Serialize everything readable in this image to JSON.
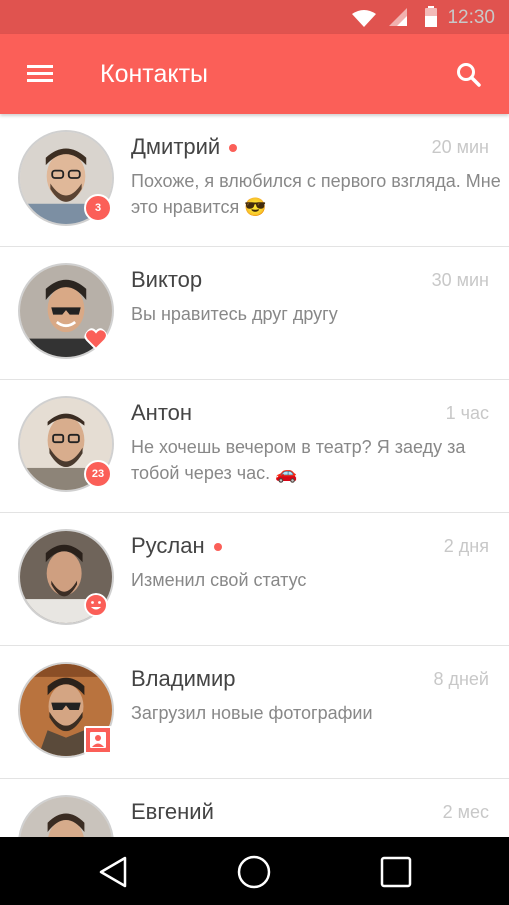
{
  "status_bar": {
    "time": "12:30",
    "icons": [
      "wifi-icon",
      "signal-icon",
      "battery-icon"
    ]
  },
  "app_bar": {
    "title": "Контакты",
    "left_icon": "menu-icon",
    "right_icon": "search-icon"
  },
  "contacts": [
    {
      "name": "Дмитрий",
      "online": true,
      "time": "20 мин",
      "message": "Похоже, я влюбился с первого взгляда. Мне это нравится 😎",
      "badge": "3"
    },
    {
      "name": "Виктор",
      "online": false,
      "time": "30 мин",
      "message": "Вы нравитесь друг другу",
      "badge_icon": "heart-icon"
    },
    {
      "name": "Антон",
      "online": false,
      "time": "1 час",
      "message": "Не хочешь вечером в театр? Я заеду за тобой через час. 🚗",
      "badge": "23"
    },
    {
      "name": "Руслан",
      "online": true,
      "time": "2 дня",
      "message": "Изменил свой статус",
      "badge_icon": "smiley-icon"
    },
    {
      "name": "Владимир",
      "online": false,
      "time": "8 дней",
      "message": "Загрузил новые фотографии",
      "badge_icon": "photo-icon"
    },
    {
      "name": "Евгений",
      "online": false,
      "time": "2 мес",
      "message": ""
    }
  ],
  "nav_bar": {
    "icons": [
      "back-icon",
      "home-icon",
      "recents-icon"
    ]
  },
  "colors": {
    "accent": "#fb5f58",
    "status_bar": "#e0534f"
  }
}
